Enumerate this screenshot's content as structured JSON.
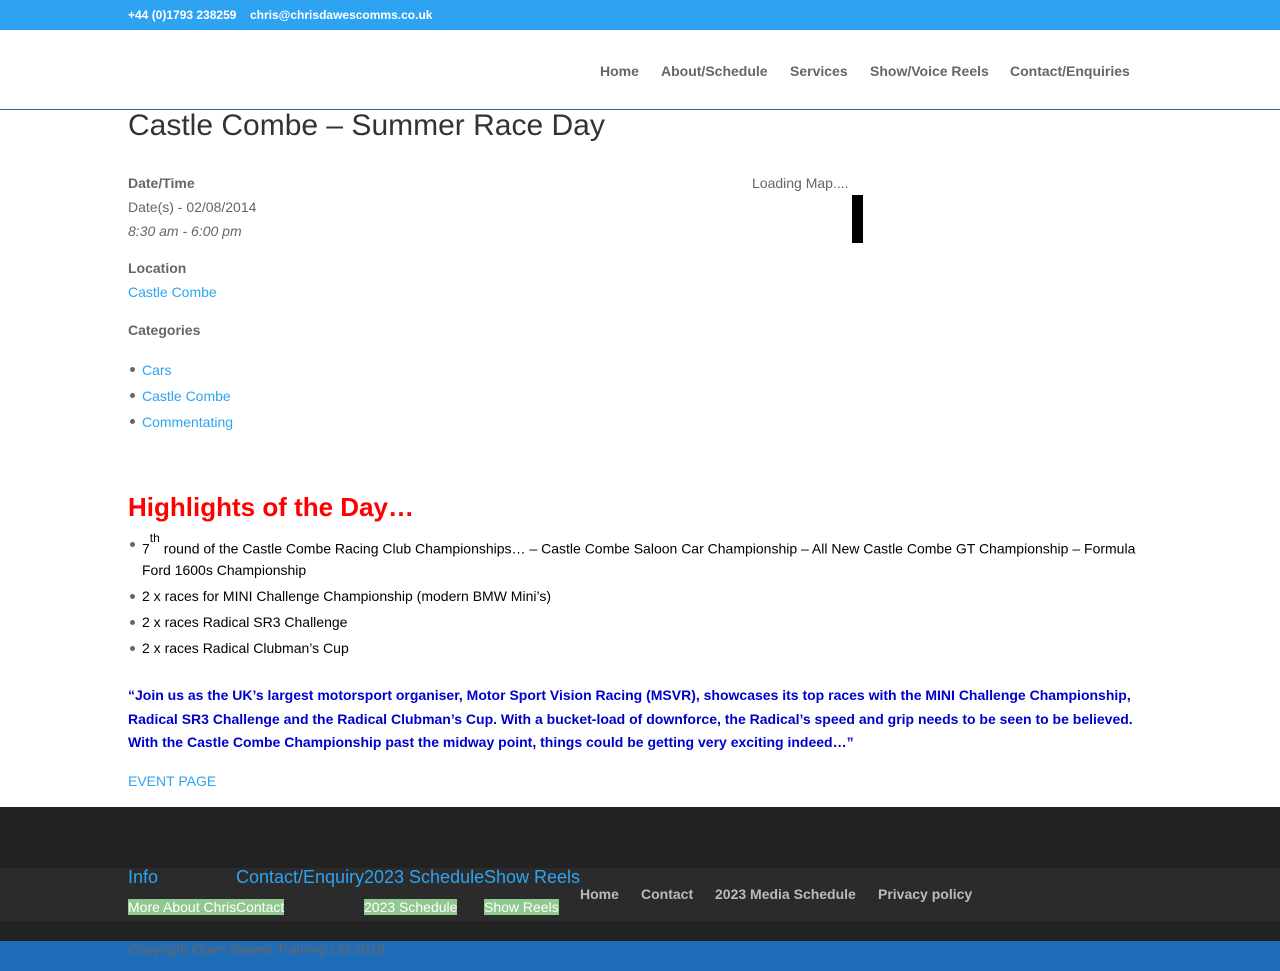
{
  "topbar": {
    "phone": "+44 (0)1793 238259",
    "email": "chris@chrisdawescomms.co.uk"
  },
  "nav": {
    "items": [
      "Home",
      "About/Schedule",
      "Services",
      "Show/Voice Reels",
      "Contact/Enquiries"
    ]
  },
  "event": {
    "title": "Castle Combe – Summer Race Day",
    "datetime_label": "Date/Time",
    "date": "Date(s) - 02/08/2014",
    "time": "8:30 am - 6:00 pm",
    "location_label": "Location",
    "location": "Castle Combe",
    "categories_label": "Categories",
    "categories": [
      "Cars",
      "Castle Combe",
      "Commentating"
    ],
    "map_text": "Loading Map...."
  },
  "highlights": {
    "title": "Highlights of the Day…",
    "item1_num": "7",
    "item1_sup": "th",
    "item1_line1": " round of the Castle Combe Racing Club Championships… –  Castle Combe Saloon Car Championship –  All New Castle Combe GT Championship –  Formula",
    "item1_line2": "Ford 1600s Championship",
    "items": [
      "2 x races for MINI Challenge Championship (modern BMW Mini’s)",
      "2 x races Radical SR3 Challenge",
      "2 x races Radical Clubman’s Cup"
    ]
  },
  "quote": "“Join us as the UK’s largest motorsport organiser, Motor Sport Vision Racing (MSVR), showcases its top races with the MINI Challenge Championship, Radical SR3 Challenge and the Radical Clubman’s Cup. With a bucket-load of downforce, the Radical’s speed and grip needs to be seen to be believed. With the Castle Combe Championship past the midway point, things could be getting very exciting indeed…”",
  "event_page_link": "EVENT PAGE",
  "footer": {
    "widgets": [
      {
        "title": "Info",
        "link": "More About Chris"
      },
      {
        "title": "Contact/Enquiry",
        "link": "Contact"
      },
      {
        "title": "2023 Schedule",
        "link": "2023 Schedule"
      },
      {
        "title": "Show Reels",
        "link": "Show Reels"
      }
    ],
    "nav": [
      "Home",
      "Contact",
      "2023 Media Schedule",
      "Privacy policy"
    ],
    "copyright": "Copyright Open Dawes Training Ltd 2019"
  },
  "colors": {
    "accent": "#2ea3f2",
    "heading_red": "#ff0000",
    "quote_blue": "#0000cc",
    "footer_bg": "#222222"
  }
}
